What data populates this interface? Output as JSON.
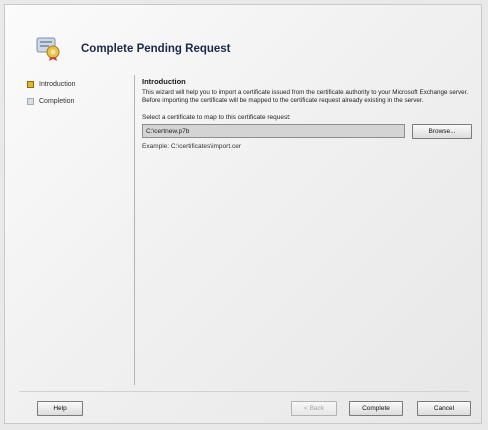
{
  "window": {
    "title": "Complete Pending Request"
  },
  "nav": {
    "items": [
      {
        "label": "Introduction",
        "state": "active"
      },
      {
        "label": "Completion",
        "state": "inactive"
      }
    ]
  },
  "content": {
    "section_title": "Introduction",
    "description": "This wizard will help you to import a certificate issued from the certificate authority to your Microsoft Exchange server. Before importing the certificate will be mapped to the certificate request already existing in the server.",
    "select_label": "Select a certificate to map to this certificate request:",
    "path_value": "C:\\certnew.p7b",
    "browse_label": "Browse...",
    "example": "Example: C:\\certificates\\import.cer"
  },
  "footer": {
    "help_label": "Help",
    "back_label": "< Back",
    "complete_label": "Complete",
    "cancel_label": "Cancel"
  },
  "colors": {
    "active_marker": "#e6b42a",
    "inactive_marker": "#d8dde3",
    "title": "#1b2a4a"
  },
  "icons": {
    "header": "certificate-wizard-icon"
  }
}
